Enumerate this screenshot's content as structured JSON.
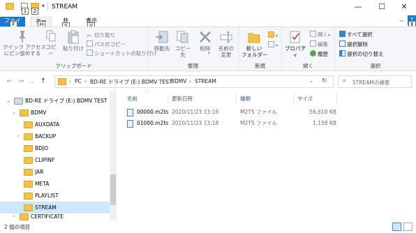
{
  "window": {
    "title": "STREAM",
    "controls": {
      "minimize": "—",
      "maximize": "☐",
      "close": "✕"
    }
  },
  "quick_access": {
    "keytips": [
      "1",
      "2"
    ]
  },
  "ribbon_tabs": [
    {
      "label": "ファイル",
      "keytip": "F"
    },
    {
      "label": "ホーム",
      "keytip": "H"
    },
    {
      "label": "共有",
      "keytip": "S"
    },
    {
      "label": "表示",
      "keytip": "V"
    }
  ],
  "ribbon_groups": {
    "clipboard": {
      "label": "クリップボード",
      "pin_label": "クイック アクセス\nにピン留めする",
      "copy_label": "コピー",
      "paste_label": "貼り付け",
      "cut_label": "切り取り",
      "copy_path_label": "パスのコピー",
      "paste_shortcut_label": "ショートカットの貼り付け"
    },
    "organize": {
      "label": "整理",
      "move_label": "移動先",
      "copy_to_label": "コピー先",
      "delete_label": "削除",
      "rename_label": "名前の\n変更"
    },
    "new": {
      "label": "新規",
      "new_folder_label": "新しい\nフォルダー"
    },
    "open": {
      "label": "開く",
      "properties_label": "プロパティ",
      "open_label": "開く",
      "edit_label": "編集",
      "history_label": "履歴"
    },
    "select": {
      "label": "選択",
      "select_all_label": "すべて選択",
      "select_none_label": "選択解除",
      "invert_label": "選択の切り替え"
    }
  },
  "address": {
    "breadcrumbs": [
      "PC",
      "BD-RE ドライブ (E:) BDMV TEST",
      "BDMV",
      "STREAM"
    ],
    "search_placeholder": "STREAMの検索"
  },
  "nav_tree": [
    {
      "label": "BD-RE ドライブ (E:) BDMV TEST",
      "kind": "drive",
      "expanded": true,
      "has_children": true,
      "level": 0
    },
    {
      "label": "BDMV",
      "kind": "folder",
      "expanded": true,
      "has_children": true,
      "level": 1
    },
    {
      "label": "AUXDATA",
      "kind": "folder",
      "has_children": false,
      "level": 2
    },
    {
      "label": "BACKUP",
      "kind": "folder",
      "has_children": true,
      "level": 2
    },
    {
      "label": "BDJO",
      "kind": "folder",
      "has_children": false,
      "level": 2
    },
    {
      "label": "CLIPINF",
      "kind": "folder",
      "has_children": false,
      "level": 2
    },
    {
      "label": "JAR",
      "kind": "folder",
      "has_children": false,
      "level": 2
    },
    {
      "label": "META",
      "kind": "folder",
      "has_children": false,
      "level": 2
    },
    {
      "label": "PLAYLIST",
      "kind": "folder",
      "has_children": false,
      "level": 2
    },
    {
      "label": "STREAM",
      "kind": "folder",
      "has_children": false,
      "level": 2,
      "selected": true
    },
    {
      "label": "CERTIFICATE",
      "kind": "folder",
      "has_children": true,
      "level": 1
    }
  ],
  "file_list": {
    "columns": {
      "name": "名前",
      "date": "更新日時",
      "type": "種類",
      "size": "サイズ"
    },
    "rows": [
      {
        "name": "00000.m2ts",
        "date": "2020/11/23 13:18",
        "type": "M2TS ファイル",
        "size": "56,610 KB"
      },
      {
        "name": "01000.m2ts",
        "date": "2020/11/23 13:18",
        "type": "M2TS ファイル",
        "size": "1,158 KB"
      }
    ]
  },
  "status": {
    "item_count": "2 個の項目"
  },
  "colors": {
    "accent": "#1979ca",
    "folder": "#f1c24d",
    "selection": "#cce8ff"
  }
}
